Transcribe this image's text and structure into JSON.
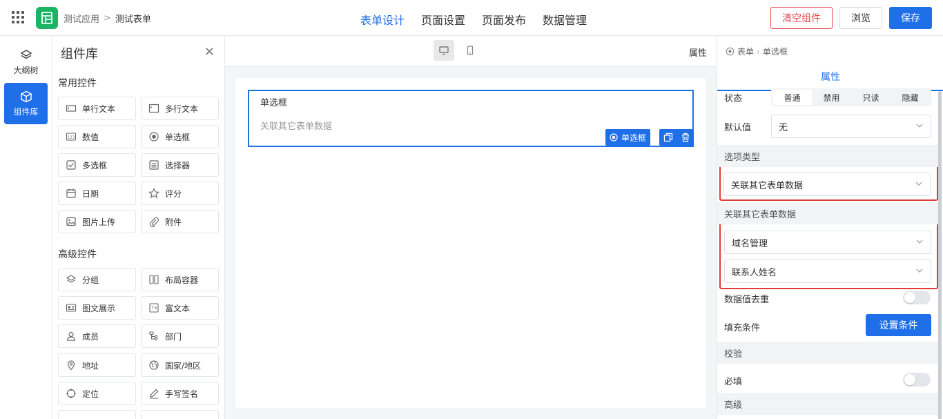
{
  "header": {
    "breadcrumb": [
      "测试应用",
      "测试表单"
    ],
    "breadcrumb_sep": ">",
    "tabs": [
      {
        "label": "表单设计",
        "active": true
      },
      {
        "label": "页面设置",
        "active": false
      },
      {
        "label": "页面发布",
        "active": false
      },
      {
        "label": "数据管理",
        "active": false
      }
    ],
    "clear_label": "清空组件",
    "preview_label": "浏览",
    "save_label": "保存"
  },
  "leftbar": {
    "outline_label": "大纲树",
    "library_label": "组件库"
  },
  "library": {
    "title": "组件库",
    "close": "×",
    "common_title": "常用控件",
    "common": [
      "单行文本",
      "多行文本",
      "数值",
      "单选框",
      "多选框",
      "选择器",
      "日期",
      "评分",
      "图片上传",
      "附件"
    ],
    "advanced_title": "高级控件",
    "advanced": [
      "分组",
      "布局容器",
      "图文展示",
      "富文本",
      "成员",
      "部门",
      "地址",
      "国家/地区",
      "定位",
      "手写签名"
    ]
  },
  "canvas": {
    "props_label": "属性",
    "field_label": "单选框",
    "field_placeholder": "关联其它表单数据",
    "field_tag": "单选框"
  },
  "props": {
    "breadcrumb": [
      "表单",
      "单选框"
    ],
    "tab": "属性",
    "state_label": "状态",
    "state_options": [
      "普通",
      "禁用",
      "只读",
      "隐藏"
    ],
    "default_label": "默认值",
    "default_value": "无",
    "option_type_title": "选项类型",
    "option_type_value": "关联其它表单数据",
    "linked_title": "关联其它表单数据",
    "linked_form": "域名管理",
    "linked_field": "联系人姓名",
    "dedupe_label": "数据值去重",
    "fill_label": "填充条件",
    "fill_button": "设置条件",
    "validate_title": "校验",
    "required_label": "必填",
    "advanced_title": "高级"
  },
  "colors": {
    "accent": "#1f6fe8",
    "danger": "#e53935",
    "logo": "#1bb464"
  }
}
